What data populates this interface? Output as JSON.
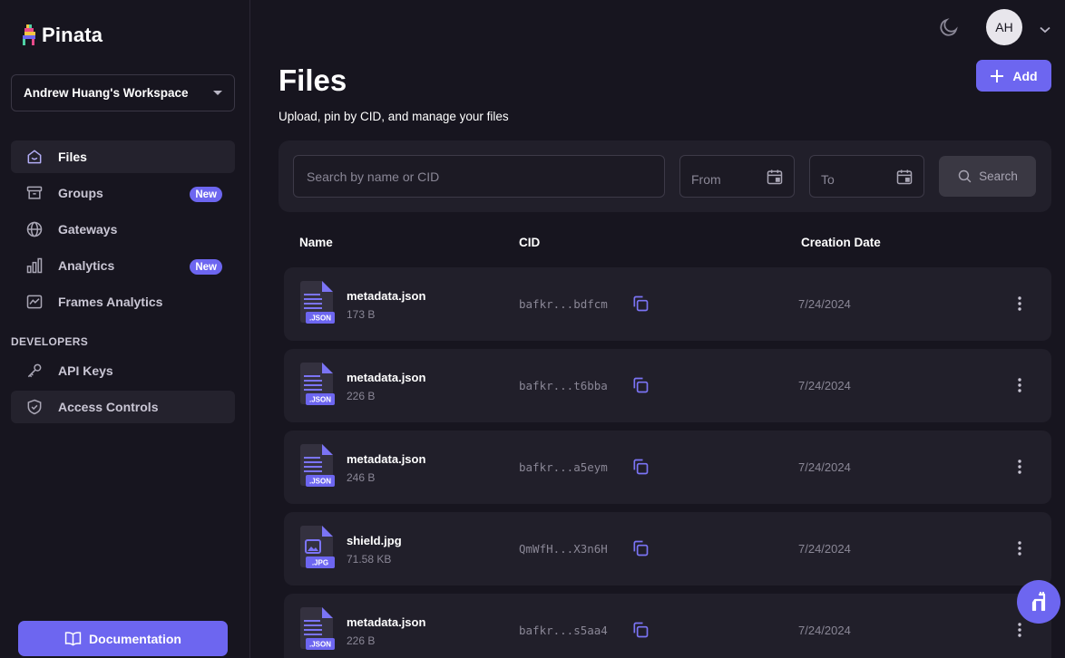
{
  "app": {
    "brand": "Pinata",
    "workspace": "Andrew Huang's Workspace"
  },
  "sidebar": {
    "items": [
      {
        "label": "Files",
        "icon": "home-icon",
        "active": true
      },
      {
        "label": "Groups",
        "icon": "archive-icon",
        "badge": "New"
      },
      {
        "label": "Gateways",
        "icon": "globe-icon"
      },
      {
        "label": "Analytics",
        "icon": "bar-chart-icon",
        "badge": "New"
      },
      {
        "label": "Frames Analytics",
        "icon": "line-chart-icon"
      }
    ],
    "developers_label": "DEVELOPERS",
    "dev_items": [
      {
        "label": "API Keys",
        "icon": "key-icon"
      },
      {
        "label": "Access Controls",
        "icon": "shield-icon",
        "active": true
      }
    ],
    "documentation_label": "Documentation"
  },
  "header": {
    "avatar_initials": "AH"
  },
  "main": {
    "title": "Files",
    "subtitle": "Upload, pin by CID, and manage your files",
    "add_label": "Add",
    "filters": {
      "search_placeholder": "Search by name or CID",
      "from_label": "From",
      "to_label": "To",
      "search_button": "Search"
    },
    "columns": [
      "Name",
      "CID",
      "Creation Date"
    ],
    "rows": [
      {
        "name": "metadata.json",
        "size": "173 B",
        "type": ".JSON",
        "cid": "bafkr...bdfcm",
        "date": "7/24/2024"
      },
      {
        "name": "metadata.json",
        "size": "226 B",
        "type": ".JSON",
        "cid": "bafkr...t6bba",
        "date": "7/24/2024"
      },
      {
        "name": "metadata.json",
        "size": "246 B",
        "type": ".JSON",
        "cid": "bafkr...a5eym",
        "date": "7/24/2024"
      },
      {
        "name": "shield.jpg",
        "size": "71.58 KB",
        "type": ".JPG",
        "cid": "QmWfH...X3n6H",
        "date": "7/24/2024"
      },
      {
        "name": "metadata.json",
        "size": "226 B",
        "type": ".JSON",
        "cid": "bafkr...s5aa4",
        "date": "7/24/2024"
      }
    ]
  },
  "colors": {
    "accent": "#6d66f0",
    "background": "#17151f",
    "card": "#211f2a"
  }
}
